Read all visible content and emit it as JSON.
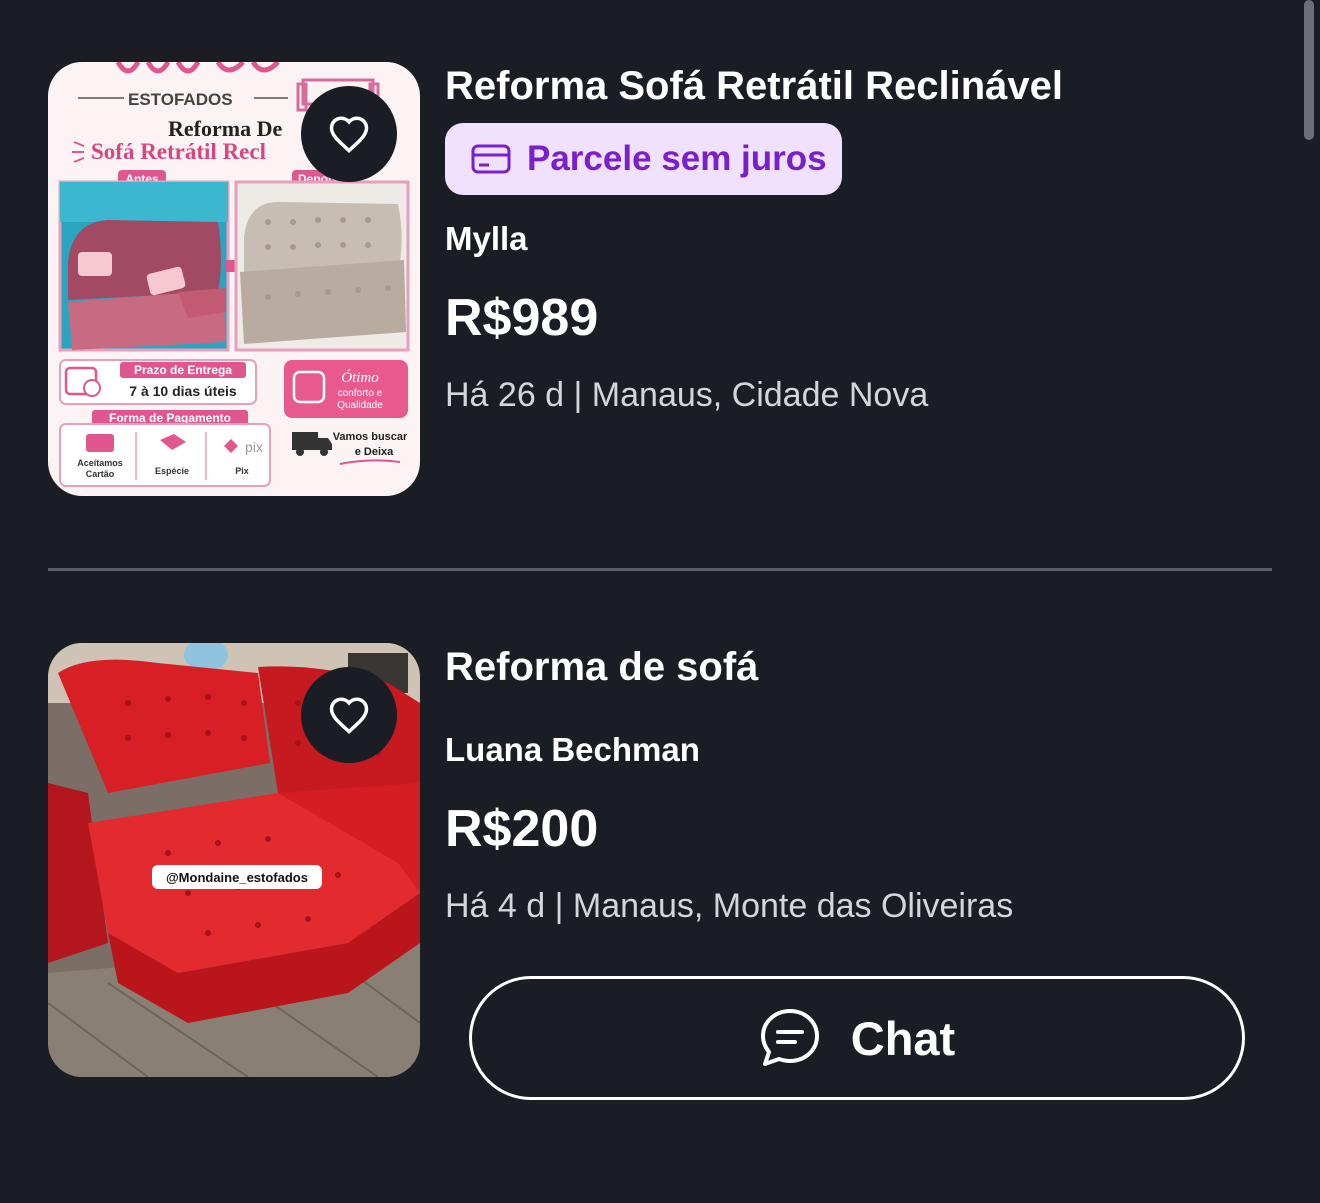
{
  "listings": [
    {
      "title": "Reforma Sofá Retrátil Reclinável",
      "badge": "Parcele sem juros",
      "seller": "Mylla",
      "price": "R$989",
      "meta": "Há 26 d | Manaus, Cidade Nova",
      "image": {
        "brand": "ESTOFADOS",
        "headline_1": "Reforma De",
        "headline_2": "Sofá Retrátil Recl",
        "before": "Antes",
        "after": "Depois",
        "delivery_title": "Prazo de Entrega",
        "delivery_value": "7 à 10 dias úteis",
        "comfort_1": "Ótimo",
        "comfort_2": "conforto e",
        "comfort_3": "Qualidade",
        "payment_title": "Forma de Pagamento",
        "card_1": "Aceitamos",
        "card_2": "Cartão",
        "cash": "Espécie",
        "pix_logo": "pix",
        "pix": "Pix",
        "pickup_1": "Vamos buscar",
        "pickup_2": "e Deixa"
      }
    },
    {
      "title": "Reforma de sofá",
      "seller": "Luana Bechman",
      "price": "R$200",
      "meta": "Há 4 d | Manaus, Monte das Oliveiras",
      "image": {
        "watermark": "@Mondaine_estofados"
      },
      "chat_label": "Chat"
    }
  ],
  "icons": {
    "favorite": "heart-outline-icon",
    "badge": "credit-card-icon",
    "chat": "chat-bubble-icon"
  },
  "colors": {
    "background": "#1a1d24",
    "badge_bg": "#efe1ff",
    "badge_text": "#7b1fc8",
    "divider": "#5b5e69"
  }
}
